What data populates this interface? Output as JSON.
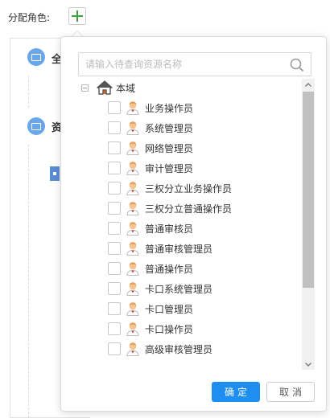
{
  "form": {
    "role_label": "分配角色:"
  },
  "background": {
    "section1_text": "全",
    "section2_text": "资"
  },
  "popup": {
    "search_placeholder": "请输入待查询资源名称",
    "root_label": "本域",
    "items": [
      {
        "label": "业务操作员"
      },
      {
        "label": "系统管理员"
      },
      {
        "label": "网络管理员"
      },
      {
        "label": "审计管理员"
      },
      {
        "label": "三权分立业务操作员"
      },
      {
        "label": "三权分立普通操作员"
      },
      {
        "label": "普通审核员"
      },
      {
        "label": "普通审核管理员"
      },
      {
        "label": "普通操作员"
      },
      {
        "label": "卡口系统管理员"
      },
      {
        "label": "卡口管理员"
      },
      {
        "label": "卡口操作员"
      },
      {
        "label": "高级审核管理员"
      }
    ],
    "confirm_label": "确定",
    "cancel_label": "取消"
  },
  "icons": {
    "add": "plus-icon",
    "search": "search-icon",
    "root": "home-icon",
    "item": "user-icon"
  },
  "colors": {
    "primary": "#1e8ff0",
    "add_icon": "#3aa635",
    "user_skin": "#f5c48f",
    "home_roof": "#555555"
  }
}
